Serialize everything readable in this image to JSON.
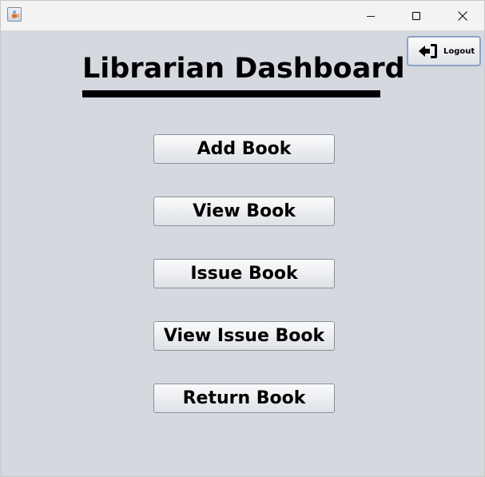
{
  "window": {
    "controls": {
      "minimize_icon": "minimize-icon",
      "maximize_icon": "maximize-icon",
      "close_icon": "close-icon"
    },
    "app_icon": "java-cup-icon"
  },
  "dashboard": {
    "title": "Librarian Dashboard",
    "logout": {
      "label": "Logout",
      "icon": "logout-arrow-icon"
    },
    "buttons": [
      {
        "label": "Add Book"
      },
      {
        "label": "View Book"
      },
      {
        "label": "Issue Book"
      },
      {
        "label": "View Issue Book"
      },
      {
        "label": "Return Book"
      }
    ]
  },
  "colors": {
    "background": "#d5d8df",
    "titlebar": "#f3f3f3",
    "logout_border": "#8aa4c4"
  }
}
